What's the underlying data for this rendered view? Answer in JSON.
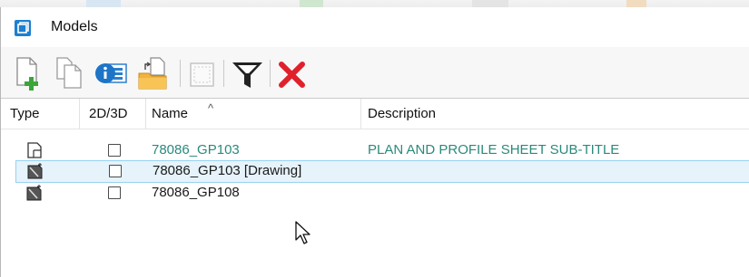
{
  "window": {
    "title": "Models"
  },
  "toolbar": {
    "buttons": [
      {
        "name": "new-model-button",
        "icon": "new-model-icon",
        "enabled": true
      },
      {
        "name": "copy-model-button",
        "icon": "copy-model-icon",
        "enabled": true
      },
      {
        "name": "model-properties-button",
        "icon": "properties-icon",
        "enabled": true
      },
      {
        "name": "import-model-button",
        "icon": "import-folder-icon",
        "enabled": true
      },
      {
        "name": "fit-view-button",
        "icon": "blank-frame-icon",
        "enabled": false
      },
      {
        "name": "filter-button",
        "icon": "filter-funnel-icon",
        "enabled": true
      },
      {
        "name": "delete-model-button",
        "icon": "red-x-delete-icon",
        "enabled": true
      }
    ]
  },
  "table": {
    "columns": {
      "type": "Type",
      "dim": "2D/3D",
      "name": "Name",
      "description": "Description"
    },
    "sort_indicator": "^",
    "rows": [
      {
        "type_icon": "sheet-model-icon",
        "checked": false,
        "name": "78086_GP103",
        "description": "PLAN AND PROFILE SHEET SUB-TITLE",
        "active": true,
        "selected": false
      },
      {
        "type_icon": "drawing-model-icon",
        "checked": false,
        "name": "78086_GP103 [Drawing]",
        "description": "",
        "active": false,
        "selected": true
      },
      {
        "type_icon": "drawing-model-icon",
        "checked": false,
        "name": "78086_GP108",
        "description": "",
        "active": false,
        "selected": false
      }
    ]
  },
  "colors": {
    "active_model_text": "#2a8a7c",
    "selection_bg": "#e6f3fb",
    "selection_border": "#99d1f0",
    "delete_red": "#e0212b"
  }
}
